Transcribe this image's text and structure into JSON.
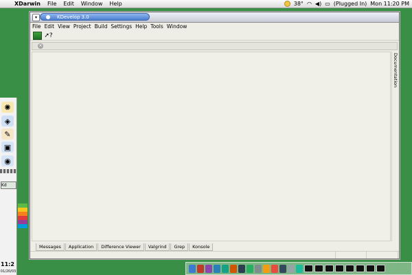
{
  "menubar": {
    "app": "XDarwin",
    "items": [
      "File",
      "Edit",
      "Window",
      "Help"
    ],
    "temperature": "38°",
    "battery": "(Plugged In)",
    "clock": "Mon 11:20 PM"
  },
  "window": {
    "title": "KDevelop 3.0",
    "menu": [
      "File",
      "Edit",
      "View",
      "Project",
      "Build",
      "Settings",
      "Help",
      "Tools",
      "Window"
    ],
    "side_tab": "Documentation",
    "bottom_tabs": [
      "Messages",
      "Application",
      "Difference Viewer",
      "Valgrind",
      "Grep",
      "Konsole"
    ]
  },
  "kicker": {
    "clock": "11:2",
    "date": "01/20/03",
    "tray_label": "Kd"
  },
  "colors": {
    "desktop": "#3a8f46",
    "title_pill": "#4c7fd0"
  }
}
